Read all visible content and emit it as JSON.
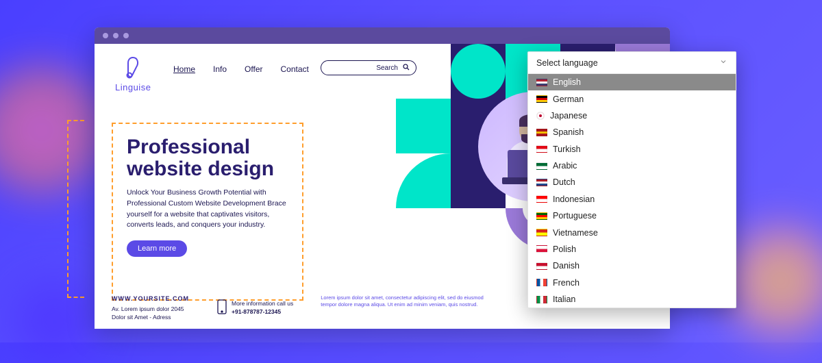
{
  "brand": {
    "name": "Linguise"
  },
  "nav": {
    "items": [
      {
        "label": "Home",
        "active": true
      },
      {
        "label": "Info",
        "active": false
      },
      {
        "label": "Offer",
        "active": false
      },
      {
        "label": "Contact",
        "active": false
      }
    ]
  },
  "search": {
    "placeholder": "Search"
  },
  "hero": {
    "title": "Professional website design",
    "body": "Unlock Your Business Growth Potential with Professional Custom Website Development Brace yourself for a website that captivates visitors, converts leads, and conquers your industry.",
    "cta": "Learn more"
  },
  "footer": {
    "site": "WWW.YOURSITE.COM",
    "address1": "Av. Lorem ipsum dolor 2045",
    "address2": "Dolor sit Amet - Adress",
    "phone_label": "More information call us",
    "phone_number": "+91-878787-12345",
    "lorem": "Lorem ipsum dolor sit amet, consectetur adipiscing elit, sed do eiusmod tempor dolore magna aliqua. Ut enim ad minim veniam, quis nostrud."
  },
  "language_dropdown": {
    "label": "Select language",
    "selected": "English",
    "options": [
      {
        "name": "English",
        "flag_colors": [
          "#b22234",
          "#ffffff",
          "#3c3b6e"
        ]
      },
      {
        "name": "German",
        "flag_colors": [
          "#000000",
          "#dd0000",
          "#ffce00"
        ]
      },
      {
        "name": "Japanese",
        "flag_colors": [
          "#ffffff",
          "#bc002d"
        ],
        "round": true
      },
      {
        "name": "Spanish",
        "flag_colors": [
          "#aa151b",
          "#f1bf00",
          "#aa151b"
        ]
      },
      {
        "name": "Turkish",
        "flag_colors": [
          "#e30a17",
          "#ffffff"
        ]
      },
      {
        "name": "Arabic",
        "flag_colors": [
          "#006c35",
          "#ffffff"
        ]
      },
      {
        "name": "Dutch",
        "flag_colors": [
          "#ae1c28",
          "#ffffff",
          "#21468b"
        ]
      },
      {
        "name": "Indonesian",
        "flag_colors": [
          "#ff0000",
          "#ffffff"
        ]
      },
      {
        "name": "Portuguese",
        "flag_colors": [
          "#006600",
          "#ff0000",
          "#ffcc00"
        ]
      },
      {
        "name": "Vietnamese",
        "flag_colors": [
          "#da251d",
          "#ffff00"
        ]
      },
      {
        "name": "Polish",
        "flag_colors": [
          "#ffffff",
          "#dc143c"
        ]
      },
      {
        "name": "Danish",
        "flag_colors": [
          "#c8102e",
          "#ffffff"
        ]
      },
      {
        "name": "French",
        "flag_colors": [
          "#0055a4",
          "#ffffff",
          "#ef4135"
        ],
        "vertical": true
      },
      {
        "name": "Italian",
        "flag_colors": [
          "#009246",
          "#ffffff",
          "#ce2b37"
        ],
        "vertical": true
      }
    ]
  }
}
